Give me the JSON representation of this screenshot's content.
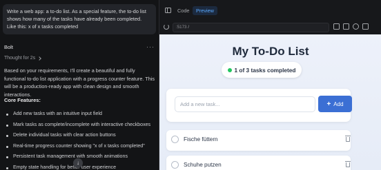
{
  "chat": {
    "user_message": "Write a web app: a to-do list. As a special feature, the to-do list shows how many of the tasks have already been completed. Like this: x of x tasks completed",
    "assistant_name": "Bolt",
    "menu_icon": "more-dots-icon",
    "thought": "Thought for 2s",
    "reply": "Based on your requirements, I'll create a beautiful and fully functional to-do list application with a progress counter feature. This will be a production-ready app with clean design and smooth interactions.",
    "core_heading": "Core Features:",
    "features": [
      "Add new tasks with an intuitive input field",
      "Mark tasks as complete/incomplete with interactive checkboxes",
      "Delete individual tasks with clear action buttons",
      "Real-time progress counter showing \"x of x tasks completed\"",
      "Persistent task management with smooth animations",
      "Empty state handling for better user experience"
    ],
    "scroll_icon": "arrow-down-icon"
  },
  "toolbar": {
    "tab_code": "Code",
    "tab_preview": "Preview",
    "active_tab": "Preview",
    "accent_color": "#5aa9ff"
  },
  "address": {
    "port": ":5173",
    "path": "/"
  },
  "app": {
    "title": "My To-Do List",
    "progress": "1 of 3 tasks completed",
    "input_placeholder": "Add a new task...",
    "add_label": "Add",
    "tasks": [
      {
        "label": "Fische füttern"
      },
      {
        "label": "Schuhe putzen"
      }
    ],
    "button_color": "#3b6fd4",
    "status_color": "#22c55e"
  }
}
